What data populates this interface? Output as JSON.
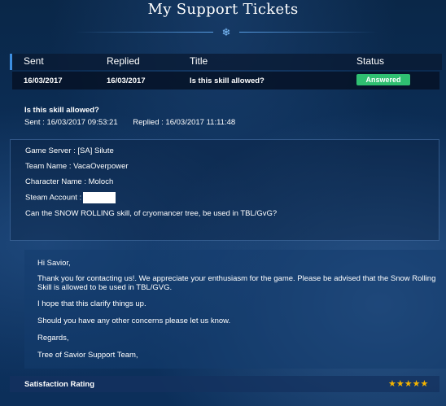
{
  "page_title": "My Support Tickets",
  "ornament_icon": "snowflake-ornament",
  "table": {
    "headers": [
      "Sent",
      "Replied",
      "Title",
      "Status"
    ],
    "rows": [
      {
        "sent": "16/03/2017",
        "replied": "16/03/2017",
        "title": "Is this skill allowed?",
        "status": "Answered"
      }
    ]
  },
  "ticket": {
    "subject": "Is this skill allowed?",
    "sent": "Sent : 16/03/2017 09:53:21",
    "replied": "Replied : 16/03/2017 11:11:48"
  },
  "request": {
    "game_server": "Game Server : [SA] Silute",
    "team_name": "Team Name : VacaOverpower",
    "character_name": "Character Name : Moloch",
    "steam_account": "Steam Account :",
    "question": "Can the SNOW ROLLING skill, of cryomancer tree, be used in TBL/GvG?"
  },
  "answer": {
    "greeting": "Hi Savior,",
    "body_1": "Thank you for contacting us!. We appreciate your enthusiasm for the game. Please be advised that the Snow Rolling Skill is allowed to be used in TBL/GVG.",
    "body_2": "I hope that this clarify things up.",
    "body_3": "Should you have any other concerns please let us know.",
    "closing": "Regards,",
    "signature": "Tree of Savior Support Team,"
  },
  "rating": {
    "label": "Satisfaction Rating",
    "stars": 5,
    "stars_text": "★★★★★"
  },
  "colors": {
    "background": "#0b2a4e",
    "status_answered": "#2fbf71",
    "accent": "#3d8ee0",
    "star": "#f4b400"
  }
}
